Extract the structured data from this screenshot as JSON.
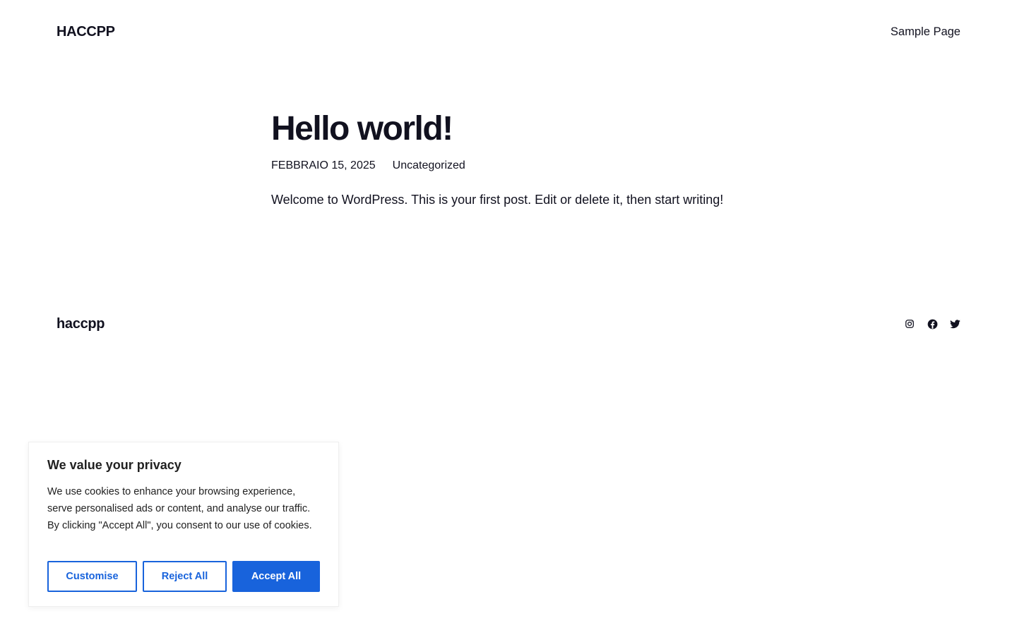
{
  "header": {
    "site_title": "HACCPP",
    "nav": [
      {
        "label": "Sample Page"
      }
    ]
  },
  "post": {
    "title": "Hello world!",
    "date": "FEBBRAIO 15, 2025",
    "category": "Uncategorized",
    "content": "Welcome to WordPress. This is your first post. Edit or delete it, then start writing!"
  },
  "footer": {
    "site_title": "haccpp",
    "social": [
      {
        "icon": "instagram-icon"
      },
      {
        "icon": "facebook-icon"
      },
      {
        "icon": "twitter-icon"
      }
    ]
  },
  "cookie_banner": {
    "title": "We value your privacy",
    "text": "We use cookies to enhance your browsing experience, serve personalised ads or content, and analyse our traffic. By clicking \"Accept All\", you consent to our use of cookies.",
    "buttons": {
      "customise": "Customise",
      "reject": "Reject All",
      "accept": "Accept All"
    },
    "accent_color": "#1863dc"
  },
  "colors": {
    "text": "#11111f",
    "background": "#ffffff"
  }
}
